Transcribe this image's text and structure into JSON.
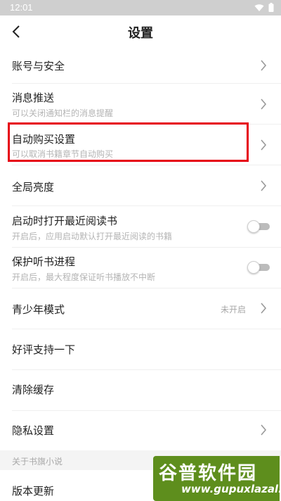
{
  "status_bar": {
    "time": "12:01"
  },
  "header": {
    "title": "设置"
  },
  "settings": {
    "account": {
      "label": "账号与安全"
    },
    "push": {
      "label": "消息推送",
      "desc": "可以关闭通知栏的消息提醒"
    },
    "auto_buy": {
      "label": "自动购买设置",
      "desc": "可以取消书籍章节自动购买"
    },
    "brightness": {
      "label": "全局亮度"
    },
    "open_recent": {
      "label": "启动时打开最近阅读书",
      "desc": "开启后，应用启动默认打开最近阅读的书籍",
      "enabled": false
    },
    "listen_progress": {
      "label": "保护听书进程",
      "desc": "开启后，最大程度保证听书播放不中断",
      "enabled": false
    },
    "teen_mode": {
      "label": "青少年模式",
      "status": "未开启"
    },
    "rate": {
      "label": "好评支持一下"
    },
    "clear_cache": {
      "label": "清除缓存"
    },
    "privacy": {
      "label": "隐私设置"
    }
  },
  "about_section": {
    "header": "关于书旗小说",
    "version_update": {
      "label": "版本更新"
    }
  },
  "watermark": {
    "title": "谷普软件园",
    "url": "www.gupuxlazal.com"
  },
  "colors": {
    "highlight": "#e60012",
    "watermark_bg": "#5e8e1d"
  }
}
